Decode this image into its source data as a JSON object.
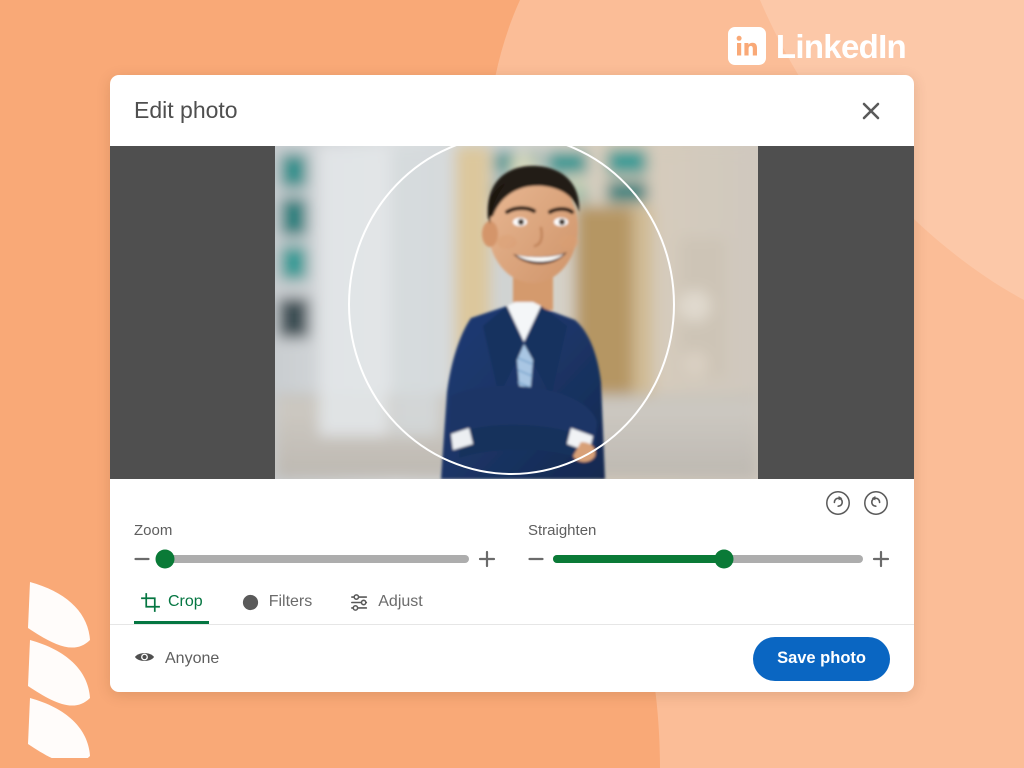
{
  "brand": {
    "logo_text": "LinkedIn",
    "logo_badge_text": "in",
    "logo_color": "#ffffff",
    "background_color": "#f9a977",
    "background_accent_color": "#fbbd97"
  },
  "dialog": {
    "title": "Edit photo",
    "close_icon": "close-icon"
  },
  "stage": {
    "backdrop_color": "#4f4f4f",
    "crop_shape": "circle",
    "crop_ring_color": "#ffffff",
    "photo_alt": "Smiling man in navy blue suit with light blue striped tie, arms crossed, blurred office interior background"
  },
  "rotate": {
    "clockwise_icon": "rotate-clockwise-icon",
    "counter_clockwise_icon": "rotate-counter-clockwise-icon"
  },
  "sliders": [
    {
      "id": "zoom",
      "label": "Zoom",
      "value": 2,
      "min": 0,
      "max": 100,
      "fill_color": "#0a7a37",
      "track_color": "#adadad",
      "decrease_icon": "minus-icon",
      "increase_icon": "plus-icon"
    },
    {
      "id": "straighten",
      "label": "Straighten",
      "value": 55,
      "min": 0,
      "max": 100,
      "fill_color": "#0a7a37",
      "track_color": "#adadad",
      "decrease_icon": "minus-icon",
      "increase_icon": "plus-icon"
    }
  ],
  "tabs": [
    {
      "label": "Crop",
      "icon": "crop-icon",
      "active": true
    },
    {
      "label": "Filters",
      "icon": "filters-circle-icon",
      "active": false
    },
    {
      "label": "Adjust",
      "icon": "adjust-sliders-icon",
      "active": false
    }
  ],
  "footer": {
    "visibility_label": "Anyone",
    "visibility_icon": "eye-icon",
    "save_label": "Save photo",
    "save_color": "#0a66c2"
  }
}
